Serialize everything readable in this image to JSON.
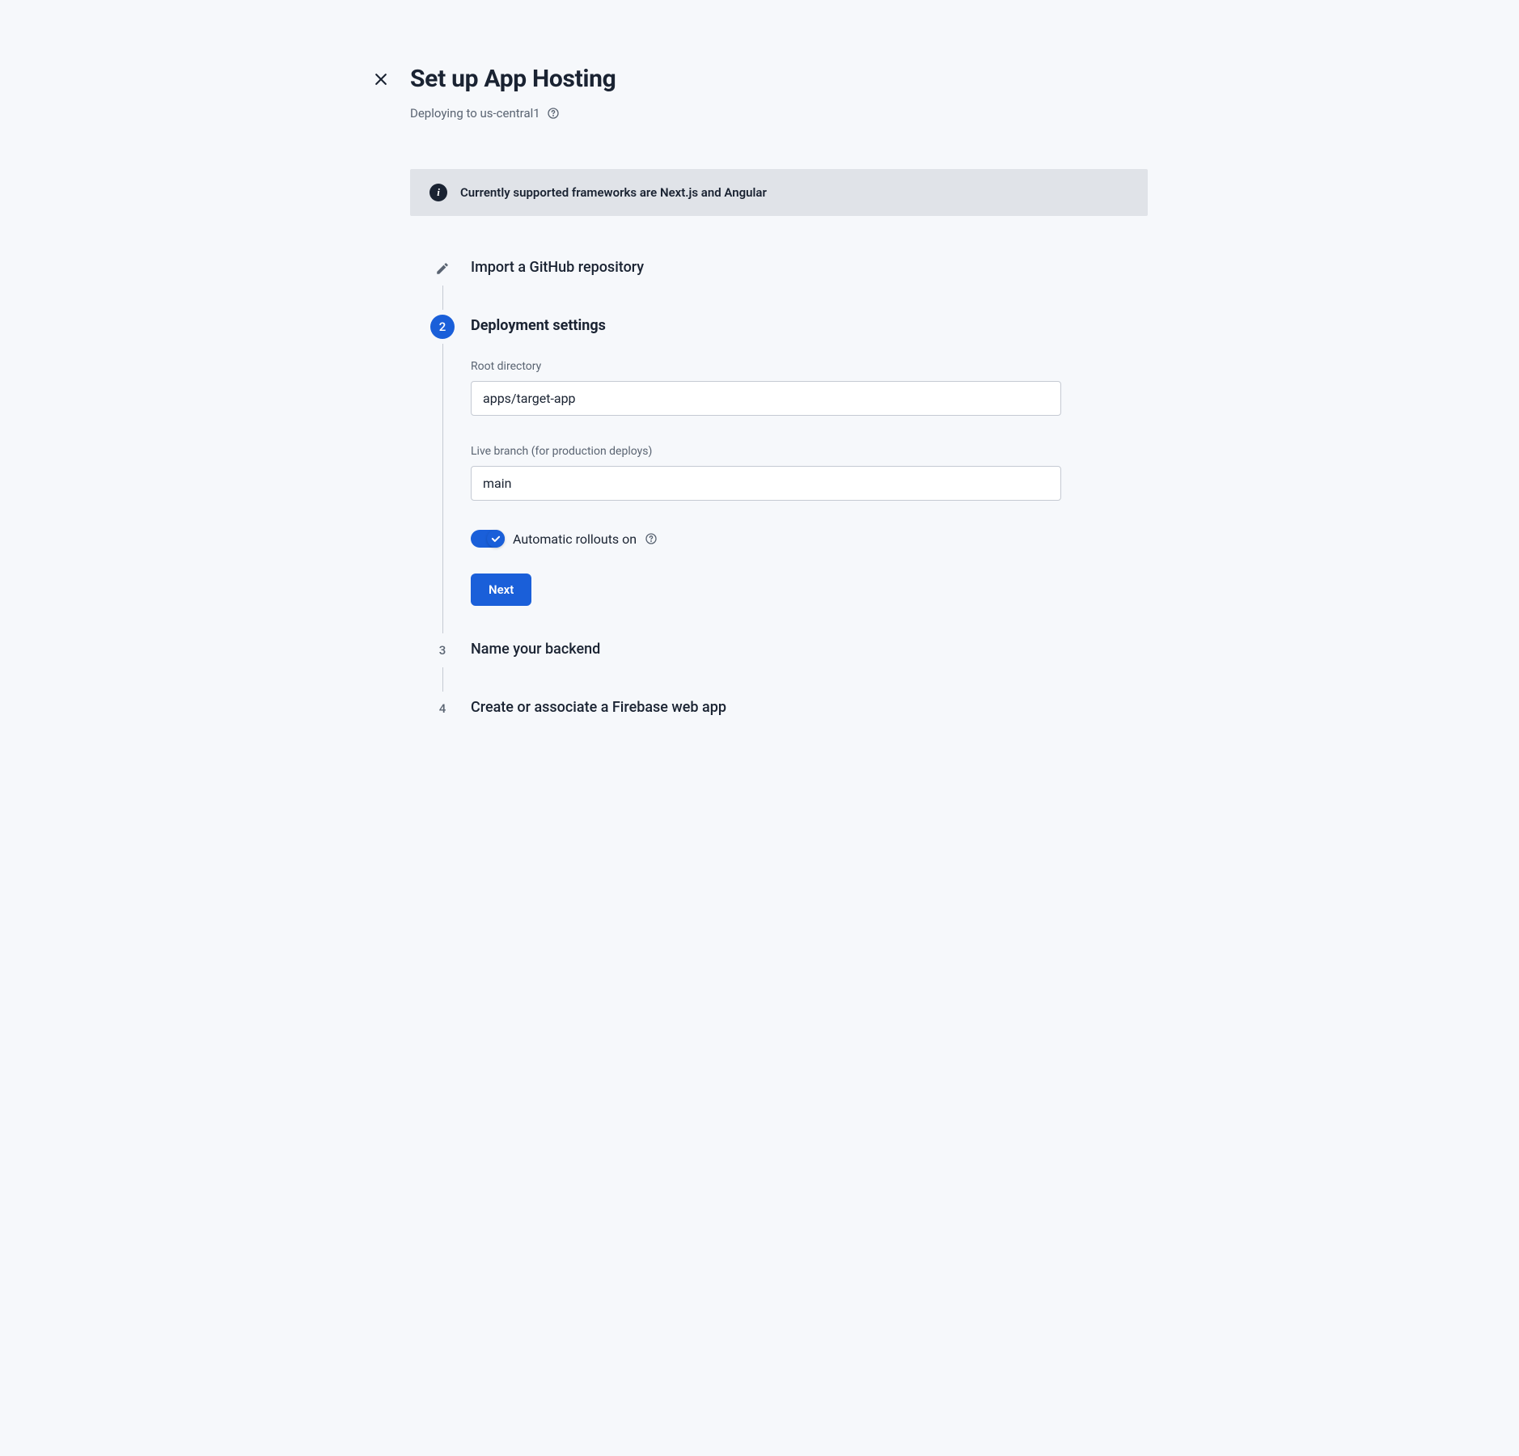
{
  "header": {
    "title": "Set up App Hosting",
    "subtitle": "Deploying to us-central1"
  },
  "banner": {
    "text": "Currently supported frameworks are Next.js and Angular"
  },
  "steps": {
    "step1": {
      "title": "Import a GitHub repository"
    },
    "step2": {
      "number": "2",
      "title": "Deployment settings",
      "root_directory_label": "Root directory",
      "root_directory_value": "apps/target-app",
      "live_branch_label": "Live branch (for production deploys)",
      "live_branch_value": "main",
      "auto_rollouts_label": "Automatic rollouts on",
      "next_button": "Next"
    },
    "step3": {
      "number": "3",
      "title": "Name your backend"
    },
    "step4": {
      "number": "4",
      "title": "Create or associate a Firebase web app"
    }
  }
}
